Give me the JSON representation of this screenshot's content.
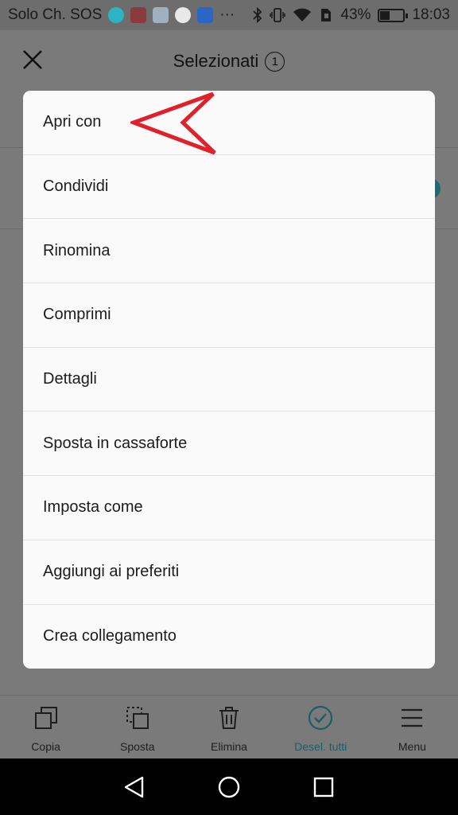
{
  "status_bar": {
    "carrier": "Solo Ch. SOS",
    "overflow": "···",
    "battery_percent": "43%",
    "battery_level": 0.43,
    "time": "18:03"
  },
  "header": {
    "title": "Selezionati",
    "selected_count": "1"
  },
  "menu": {
    "items": [
      {
        "label": "Apri con"
      },
      {
        "label": "Condividi"
      },
      {
        "label": "Rinomina"
      },
      {
        "label": "Comprimi"
      },
      {
        "label": "Dettagli"
      },
      {
        "label": "Sposta in cassaforte"
      },
      {
        "label": "Imposta come"
      },
      {
        "label": "Aggiungi ai preferiti"
      },
      {
        "label": "Crea collegamento"
      }
    ]
  },
  "toolbar": {
    "items": [
      {
        "label": "Copia",
        "icon": "copy-icon"
      },
      {
        "label": "Sposta",
        "icon": "move-icon"
      },
      {
        "label": "Elimina",
        "icon": "trash-icon"
      },
      {
        "label": "Desel. tutti",
        "icon": "check-circle-icon"
      },
      {
        "label": "Menu",
        "icon": "menu-icon"
      }
    ]
  },
  "colors": {
    "accent": "#1b5e68",
    "annotation_arrow": "#e0202a",
    "dim_background": "#7a7a7a"
  }
}
